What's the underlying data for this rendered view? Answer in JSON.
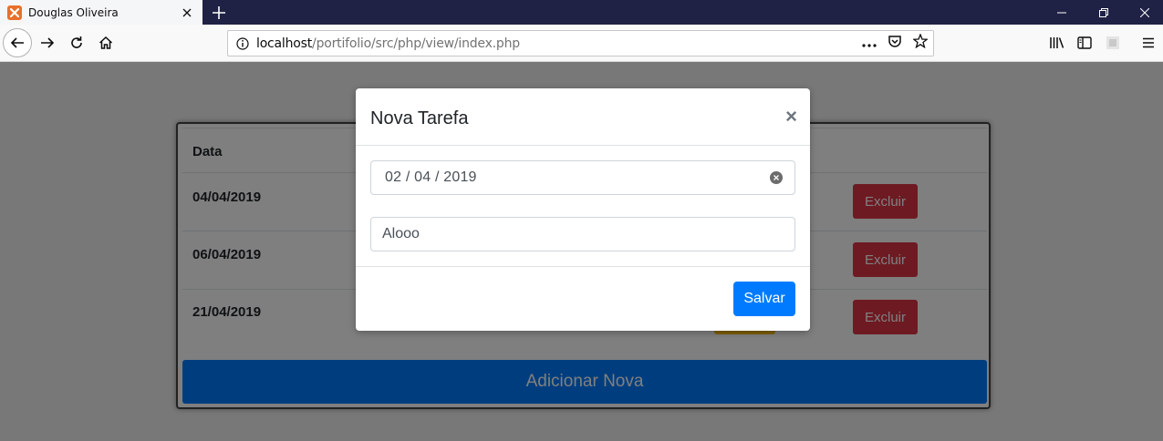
{
  "browser": {
    "tab_title": "Douglas Oliveira",
    "url_host": "localhost",
    "url_path": "/portifolio/src/php/view/index.php"
  },
  "table": {
    "header_date": "Data",
    "rows": [
      {
        "date": "04/04/2019",
        "delete_label": "Excluir"
      },
      {
        "date": "06/04/2019",
        "delete_label": "Excluir"
      },
      {
        "date": "21/04/2019",
        "delete_label": "Excluir"
      }
    ],
    "add_label": "Adicionar Nova"
  },
  "modal": {
    "title": "Nova Tarefa",
    "close_glyph": "×",
    "date_value": "02 / 04 / 2019",
    "text_value": "Alooo",
    "save_label": "Salvar"
  },
  "colors": {
    "primary": "#007bff",
    "danger": "#dc3545",
    "warning": "#ffc107"
  }
}
